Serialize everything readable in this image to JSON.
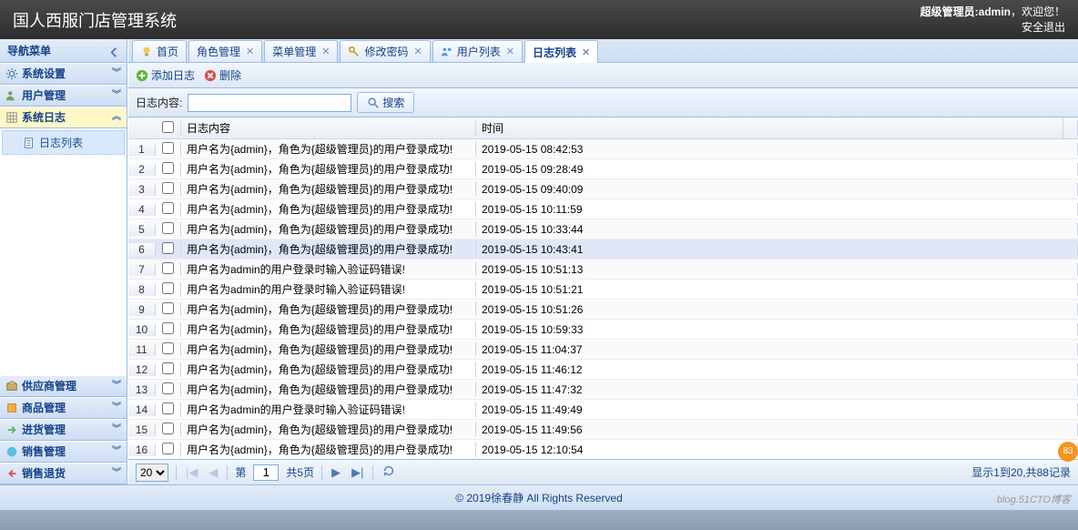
{
  "header": {
    "title": "国人西服门店管理系统",
    "welcome_prefix": "超级管理员:",
    "welcome_user": "admin",
    "welcome_suffix": "，欢迎您！",
    "logout": "安全退出"
  },
  "sidebar": {
    "title": "导航菜单",
    "panels": [
      {
        "label": "系统设置",
        "icon": "gear"
      },
      {
        "label": "用户管理",
        "icon": "users"
      },
      {
        "label": "系统日志",
        "icon": "grid",
        "active": true,
        "items": [
          {
            "label": "日志列表",
            "icon": "doc"
          }
        ]
      },
      {
        "label": "供应商管理",
        "icon": "box"
      },
      {
        "label": "商品管理",
        "icon": "goods"
      },
      {
        "label": "进货管理",
        "icon": "in"
      },
      {
        "label": "销售管理",
        "icon": "sale"
      },
      {
        "label": "销售退货",
        "icon": "return"
      }
    ]
  },
  "tabs": [
    {
      "label": "首页",
      "icon": "bulb",
      "closable": false
    },
    {
      "label": "角色管理",
      "closable": true
    },
    {
      "label": "菜单管理",
      "closable": true
    },
    {
      "label": "修改密码",
      "icon": "key",
      "closable": true
    },
    {
      "label": "用户列表",
      "icon": "users2",
      "closable": true
    },
    {
      "label": "日志列表",
      "closable": true,
      "active": true
    }
  ],
  "toolbar": {
    "add": "添加日志",
    "delete": "删除"
  },
  "search": {
    "label": "日志内容:",
    "value": "",
    "button": "搜索"
  },
  "grid": {
    "columns": {
      "content": "日志内容",
      "time": "时间"
    },
    "rows": [
      {
        "n": 1,
        "content": "用户名为{admin}，角色为{超级管理员}的用户登录成功!",
        "time": "2019-05-15 08:42:53"
      },
      {
        "n": 2,
        "content": "用户名为{admin}，角色为{超级管理员}的用户登录成功!",
        "time": "2019-05-15 09:28:49"
      },
      {
        "n": 3,
        "content": "用户名为{admin}，角色为{超级管理员}的用户登录成功!",
        "time": "2019-05-15 09:40:09"
      },
      {
        "n": 4,
        "content": "用户名为{admin}，角色为{超级管理员}的用户登录成功!",
        "time": "2019-05-15 10:11:59"
      },
      {
        "n": 5,
        "content": "用户名为{admin}，角色为{超级管理员}的用户登录成功!",
        "time": "2019-05-15 10:33:44"
      },
      {
        "n": 6,
        "content": "用户名为{admin}，角色为{超级管理员}的用户登录成功!",
        "time": "2019-05-15 10:43:41",
        "hl": true
      },
      {
        "n": 7,
        "content": "用户名为admin的用户登录时输入验证码错误!",
        "time": "2019-05-15 10:51:13"
      },
      {
        "n": 8,
        "content": "用户名为admin的用户登录时输入验证码错误!",
        "time": "2019-05-15 10:51:21"
      },
      {
        "n": 9,
        "content": "用户名为{admin}，角色为{超级管理员}的用户登录成功!",
        "time": "2019-05-15 10:51:26"
      },
      {
        "n": 10,
        "content": "用户名为{admin}，角色为{超级管理员}的用户登录成功!",
        "time": "2019-05-15 10:59:33"
      },
      {
        "n": 11,
        "content": "用户名为{admin}，角色为{超级管理员}的用户登录成功!",
        "time": "2019-05-15 11:04:37"
      },
      {
        "n": 12,
        "content": "用户名为{admin}，角色为{超级管理员}的用户登录成功!",
        "time": "2019-05-15 11:46:12"
      },
      {
        "n": 13,
        "content": "用户名为{admin}，角色为{超级管理员}的用户登录成功!",
        "time": "2019-05-15 11:47:32"
      },
      {
        "n": 14,
        "content": "用户名为admin的用户登录时输入验证码错误!",
        "time": "2019-05-15 11:49:49"
      },
      {
        "n": 15,
        "content": "用户名为{admin}，角色为{超级管理员}的用户登录成功!",
        "time": "2019-05-15 11:49:56"
      },
      {
        "n": 16,
        "content": "用户名为{admin}，角色为{超级管理员}的用户登录成功!",
        "time": "2019-05-15 12:10:54"
      }
    ]
  },
  "pager": {
    "page_size": "20",
    "page_label_prefix": "第",
    "page_value": "1",
    "page_total": "共5页",
    "info": "显示1到20,共88记录"
  },
  "footer": "© 2019徐春静 All Rights Reserved",
  "watermark": "blog.51CTO博客",
  "badge": "83"
}
